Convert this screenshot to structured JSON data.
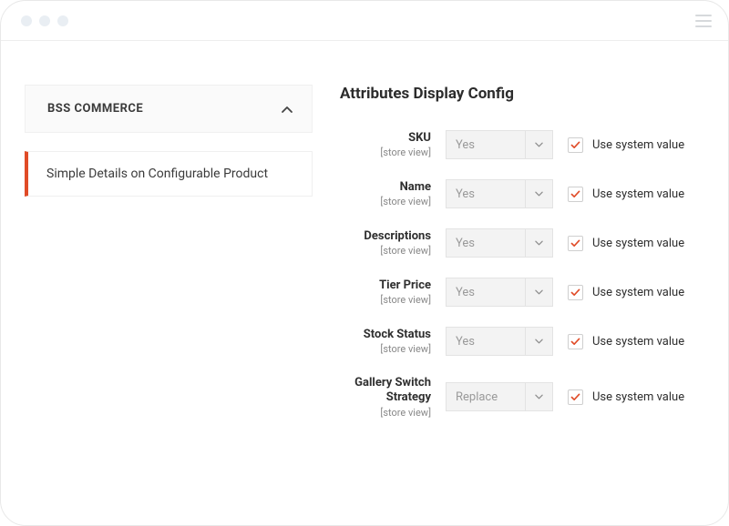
{
  "sidebar": {
    "section_title": "BSS COMMERCE",
    "active_item": "Simple Details on Configurable Product"
  },
  "main": {
    "section_title": "Attributes Display Config",
    "use_system_label": "Use system value",
    "fields": [
      {
        "label": "SKU",
        "scope": "[store view]",
        "value": "Yes",
        "use_system": true
      },
      {
        "label": "Name",
        "scope": "[store view]",
        "value": "Yes",
        "use_system": true
      },
      {
        "label": "Descriptions",
        "scope": "[store view]",
        "value": "Yes",
        "use_system": true
      },
      {
        "label": "Tier Price",
        "scope": "[store view]",
        "value": "Yes",
        "use_system": true
      },
      {
        "label": "Stock Status",
        "scope": "[store view]",
        "value": "Yes",
        "use_system": true
      },
      {
        "label": "Gallery Switch Strategy",
        "scope": "[store view]",
        "value": "Replace",
        "use_system": true
      }
    ]
  },
  "colors": {
    "accent": "#e04b27"
  }
}
